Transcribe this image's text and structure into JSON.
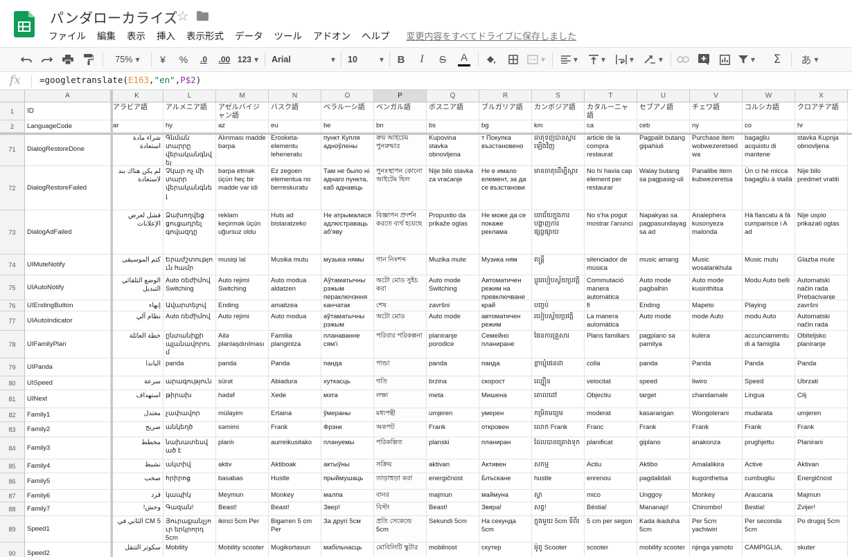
{
  "app": {
    "title": "パンダローカライズ",
    "menus": [
      "ファイル",
      "編集",
      "表示",
      "挿入",
      "表示形式",
      "データ",
      "ツール",
      "アドオン",
      "ヘルプ"
    ],
    "save_status": "変更内容をすべてドライブに保存しました",
    "colors": {
      "sheets_green": "#0f9d58",
      "toolbar_bg": "#f8f8f8"
    }
  },
  "toolbar": {
    "zoom": "75%",
    "currency": "¥",
    "percent": "%",
    "decrease_decimal": ".0",
    "increase_decimal": ".00",
    "format_more": "123",
    "font": "Arial",
    "font_size": "10",
    "bold": "B",
    "italic": "I",
    "strike": "S",
    "text_color": "A",
    "input_tools": "あ"
  },
  "formula_bar": {
    "fx": "fx",
    "prefix": "=googletranslate(",
    "ref1": "E163",
    "sep1": ",",
    "str": "\"en\"",
    "sep2": ",",
    "ref2": "P$2",
    "suffix": ")"
  },
  "grid": {
    "columns": [
      "A",
      "K",
      "L",
      "M",
      "N",
      "O",
      "P",
      "Q",
      "R",
      "S",
      "T",
      "U",
      "V",
      "W",
      "X"
    ],
    "selected_column": "P",
    "rows": [
      {
        "num": "1",
        "cells": [
          "ID",
          "アラビア語",
          "アルメニア語",
          "アゼルバイジャン語",
          "バスク語",
          "ベラルーシ語",
          "ベンガル語",
          "ボスニア語",
          "ブルガリア語",
          "カンボジア語",
          "カタルーニャ語",
          "セブアノ語",
          "チェワ語",
          "コルシカ語",
          "クロアチア語"
        ]
      },
      {
        "num": "2",
        "cells": [
          "LanguageCode",
          "ar",
          "hy",
          "az",
          "eu",
          "be",
          "bn",
          "bs",
          "bg",
          "km",
          "ca",
          "ceb",
          "ny",
          "co",
          "hr"
        ]
      },
      {
        "num": "71",
        "cells": [
          "DialogRestoreDone",
          "شراء مادة استعادة",
          "Գնման տարրը վերականգնվել",
          "Alınması madde bərpa",
          "Erosketa-elementu leheneratu",
          "пункт Купля адноўлены",
          "ক্রয় আইটেম পুনরুদ্ধার",
          "Kupovina stavka obnovljena",
          "т Покупка възстановено",
          "ធាតុទិញបានស្តារឡើងវិញ",
          "article de la compra restaurat",
          "Pagpalit butang gipahiuli",
          "Purchase item wobwezeretsedwa",
          "bagagliu acquistu di mantene",
          "stavka Kupnja obnovljena"
        ]
      },
      {
        "num": "72",
        "cells": [
          "DialogRestoreFailed",
          "لم يكن هناك بند لاستعادة",
          "Չկար ոչ մի տարր վերականգնել",
          "bərpa etmək üçün heç bir madde var idi",
          "Ez zegoen elementua no berreskuratu",
          "Там не было ні аднаго пункта, каб аднавіць",
          "পুনঃস্থাপন কোনো আইটেম ছিল",
          "Nije bilo stavka za vraćanje",
          "Не е имало елемент, за да се възстанови",
          "មានធាតុដើម្បីស្តារ",
          "No hi havia cap element per restaurar",
          "Walay butang sa pagpasig-uli",
          "Panalibe item kubwezeretsa",
          "Ùn ci hè micca bagagliu à stallà",
          "Nije bilo predmet vratiti"
        ]
      },
      {
        "num": "73",
        "cells": [
          "DialogAdFailed",
          "فشل لعرض الإعلانات",
          "Ձախողվեց ցուցադրել գովազդը",
          "reklam keçirmək üçün uğursuz oldu",
          "Huts ad bistaratzeko",
          "Не атрымалася адлюстраваць аб'яву",
          "বিজ্ঞাপন প্রদর্শন করতে ব্যর্থ হয়েছে",
          "Propustio da prikaže oglas",
          "Не може да се покаже реклама",
          "បរាជ័យក្នុងការបង្ហាញការផ្សព្វផ្សាយ",
          "No s'ha pogut mostrar l'anunci",
          "Napakyas sa pagpasundayag sa ad",
          "Analephera kusonyeza malonda",
          "Hà fiascatu à fà cumparisce i A ad",
          "Nije uspio prikazati oglas"
        ]
      },
      {
        "num": "74",
        "cells": [
          "UIMuteNotify",
          "كتم الموسيقى",
          "Երաժշտություն համր",
          "musiqi lal",
          "Musika mutu",
          "музыка нямы",
          "গান নিঃশব্দ",
          "Muzika mute",
          "Музика ням",
          "តន្ត្រី",
          "silenciador de música",
          "music amang",
          "Music wosalankhula",
          "Music mutu",
          "Glazba mute"
        ]
      },
      {
        "num": "75",
        "cells": [
          "UIAutoNotify",
          "الوضع التلقائي التبديل",
          "Auto ռեժիմով Switching",
          "Auto rejimi Switching",
          "Auto modua aldatzen",
          "Аўтаматычны рэжым пераключэння",
          "অটো মোড সুইচ করা",
          "Auto mode Switching",
          "Автоматичен режим на превключване",
          "ប្ដូររបៀបស្វ័យប្រវត្តិ",
          "Commutació manera automàtica",
          "Auto mode pagbalhin",
          "Auto mode kusinthitsa",
          "Modu Auto belli",
          "Automatski način rada Prebacivanje"
        ]
      },
      {
        "num": "76",
        "cells": [
          "UIEndingButton",
          "إنهاء",
          "Ավարտելով",
          "Ending",
          "amaitzea",
          "канчатак",
          "শেষ",
          "završni",
          "край",
          "បញ្ចប់",
          "fi",
          "Ending",
          "Mapeto",
          "Playing",
          "završni"
        ]
      },
      {
        "num": "77",
        "cells": [
          "UIAutoIndicator",
          "نظام آلي",
          "Auto ռեժիմով",
          "Auto rejimi",
          "Auto modua",
          "аўтаматычны рэжым",
          "অটো মোড",
          "Auto mode",
          "автоматичен режим",
          "របៀបស្វ័យប្រវត្តិ",
          "La manera automàtica",
          "Auto mode",
          "mode Auto",
          "modu Auto",
          "Automatski način rada"
        ]
      },
      {
        "num": "78",
        "cells": [
          "UIFamilyPlan",
          "خطة العائلة",
          "ընտանիքի պլանավորում",
          "Ailə planlaşdırılması",
          "Familia plangintza",
          "планаванне сям'і",
          "পরিবার পরিকল্পনা",
          "planiranje porodice",
          "Семейно планиране",
          "ផែនការគ្រួសារ",
          "Plans familiars",
          "pagplano sa pamilya",
          "kulera",
          "accunciamentu di a famiglia",
          "Obiteljsko planiranje"
        ]
      },
      {
        "num": "79",
        "cells": [
          "UIPanda",
          "الباندا",
          "panda",
          "panda",
          "Panda",
          "панда",
          "পান্ডা",
          "panda",
          "панда",
          "ខ្លាឃ្មុំផេនដា",
          "colla",
          "panda",
          "Panda",
          "Panda",
          "Panda"
        ]
      },
      {
        "num": "80",
        "cells": [
          "UISpeed",
          "سرعة",
          "արագություն",
          "sürət",
          "Abiadura",
          "хуткасць",
          "গতি",
          "brzina",
          "скорост",
          "ល្បឿន",
          "velocitat",
          "speed",
          "liwiro",
          "Speed",
          "Ubrzati"
        ]
      },
      {
        "num": "81",
        "cells": [
          "UINext",
          "استهداف",
          "թիրախ",
          "hədəf",
          "Xede",
          "мэта",
          "লক্ষ্য",
          "meta",
          "Мишена",
          "គោលដៅ",
          "Objectiu",
          "target",
          "chandamale",
          "Lingua",
          "Cilj"
        ]
      },
      {
        "num": "82",
        "cells": [
          "Family1",
          "معتدل",
          "չափավոր",
          "mülayim",
          "Ertaina",
          "ўмераны",
          "মধ্যপন্থী",
          "umjeren",
          "умерен",
          "កម្រិតមធ្យម",
          "moderat",
          "kasarangan",
          "Wongolerani",
          "mudarata",
          "umjeren"
        ]
      },
      {
        "num": "83",
        "cells": [
          "Family2",
          "صريح",
          "անկեղծ",
          "səmimi",
          "Frank",
          "Фрэнк",
          "অকপট",
          "Frank",
          "откровен",
          "លោក Frank",
          "Franc",
          "Frank",
          "Frank",
          "Frank",
          "Frank"
        ]
      },
      {
        "num": "84",
        "cells": [
          "Family3",
          "مخطط",
          "նախատեսված է",
          "planlı",
          "aurreikusitako",
          "плануемы",
          "পরিকল্পিত",
          "planski",
          "планиран",
          "ដែលបានគ្រោងទុក",
          "planificat",
          "giplano",
          "anakonza",
          "prughjettu",
          "Planirani"
        ]
      },
      {
        "num": "85",
        "cells": [
          "Family4",
          "نشيط",
          "ակտիվ",
          "aktiv",
          "Aktiboak",
          "актыўны",
          "সক্রিয়",
          "aktivan",
          "Активен",
          "សកម្ម",
          "Actiu",
          "Aktibo",
          "Amalalikira",
          "Active",
          "Aktivan"
        ]
      },
      {
        "num": "86",
        "cells": [
          "Family5",
          "صخب",
          "հրիրոց",
          "basabas",
          "Hustle",
          "прыймушаць",
          "তাড়াহুড়া করা",
          "energičnost",
          "Блъскане",
          "hustle",
          "enrenou",
          "pagdalidali",
          "kugonthetsa",
          "cumbugliu",
          "Energičnost"
        ]
      },
      {
        "num": "87",
        "cells": [
          "Family6",
          "قرد",
          "կապիկ",
          "Meymun",
          "Monkey",
          "малпа",
          "বানর",
          "majmun",
          "маймуна",
          "ស្វា",
          "mico",
          "Unggoy",
          "Monkey",
          "Araucaria",
          "Majmun"
        ]
      },
      {
        "num": "88",
        "cells": [
          "Family7",
          "وحش!",
          "Գազան!",
          "Beast!",
          "Beast!",
          "Звер!",
          "বিস্ট!",
          "Beast!",
          "Звяра!",
          "សត្វ!",
          "Bèstia!",
          "Mananap!",
          "Chirombo!",
          "Bestia!",
          "Zvijer!"
        ]
      },
      {
        "num": "89",
        "cells": [
          "Speed1",
          "5 CM الثاني في",
          "Յուրաքանչյուր երկրորդ 5cm",
          "ikinci 5cm Per",
          "Bigarren 5 cm Per",
          "За другі 5см",
          "প্রতি সেকেন্ডে 5cm",
          "Sekundi 5cm",
          "На секунда 5cm",
          "ក្នុងមួយ 5cm ទីពីរ",
          "5 cm per segon",
          "Kada ikaduha 5cm",
          "Per 5cm yachiwiri",
          "Per seconda 5cm",
          "Po drugoj 5cm"
        ]
      },
      {
        "num": "90",
        "cells": [
          "Speed2",
          "سكوتر التنقل",
          "Mobility",
          "Mobility scooter",
          "Mugikortasun",
          "мабільнасць",
          "মোবিলিটি স্কুটার",
          "mobilnost",
          "скутер",
          "ម៉ូតូ Scooter",
          "scooter",
          "mobility scooter",
          "njinga yamoto",
          "CAMPIGLIA,",
          "skuter"
        ]
      }
    ]
  }
}
